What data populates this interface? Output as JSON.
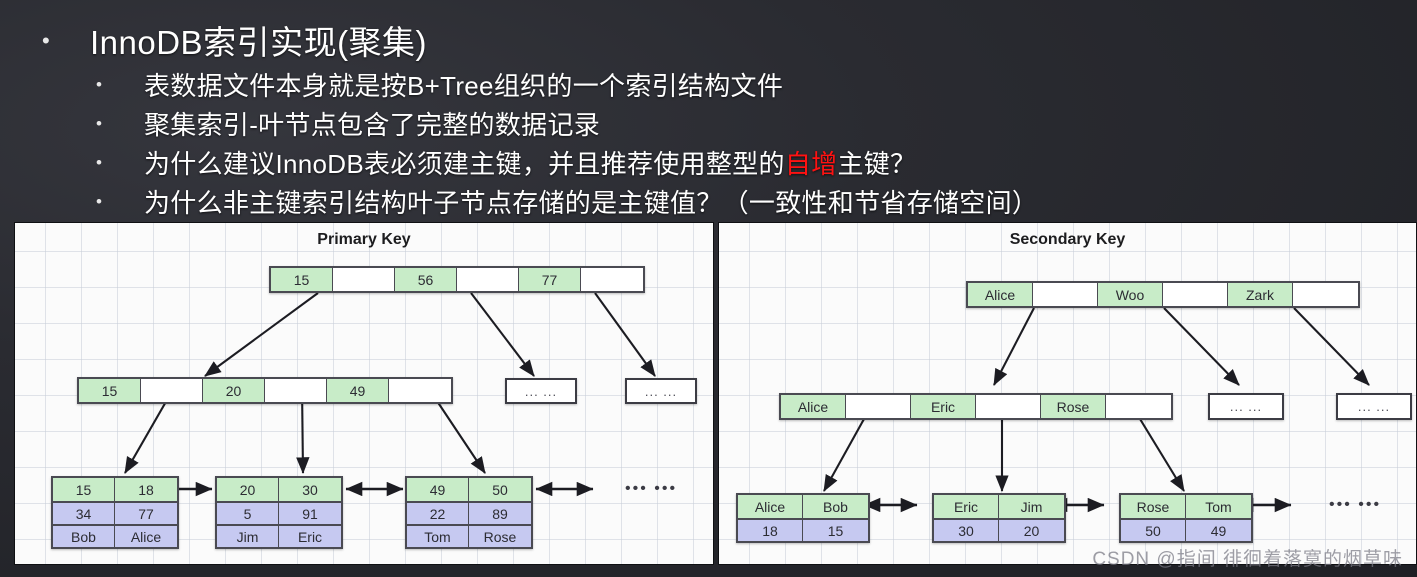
{
  "slide": {
    "bullets": [
      {
        "level": 1,
        "text": "InnoDB索引实现(聚集)"
      },
      {
        "level": 2,
        "text": "表数据文件本身就是按B+Tree组织的一个索引结构文件"
      },
      {
        "level": 2,
        "text": "聚集索引-叶节点包含了完整的数据记录"
      },
      {
        "level": 2,
        "pre": "为什么建议InnoDB表必须建主键，并且推荐使用整型的",
        "hl": "自增",
        "post": "主键？"
      },
      {
        "level": 2,
        "text": "为什么非主键索引结构叶子节点存储的是主键值？（一致性和节省存储空间）"
      }
    ]
  },
  "colors": {
    "key_green": "#c8ecc8",
    "data_purple": "#c6c9f1",
    "highlight_red": "#ff1212",
    "panel_bg": "#fbfbfb",
    "slide_bg": "#25262b"
  },
  "panels": {
    "primary": {
      "title": "Primary Key",
      "root": {
        "cells": [
          "15",
          "",
          "56",
          "",
          "77",
          ""
        ]
      },
      "internal": {
        "cells": [
          "15",
          "",
          "20",
          "",
          "49",
          ""
        ]
      },
      "internal_ellipsis": [
        "... ...",
        "... ..."
      ],
      "leaves": [
        {
          "keys": [
            "15",
            "18"
          ],
          "row2": [
            "34",
            "77"
          ],
          "row3": [
            "Bob",
            "Alice"
          ]
        },
        {
          "keys": [
            "20",
            "30"
          ],
          "row2": [
            "5",
            "91"
          ],
          "row3": [
            "Jim",
            "Eric"
          ]
        },
        {
          "keys": [
            "49",
            "50"
          ],
          "row2": [
            "22",
            "89"
          ],
          "row3": [
            "Tom",
            "Rose"
          ]
        }
      ],
      "leaf_ellipsis": "••• •••"
    },
    "secondary": {
      "title": "Secondary Key",
      "root": {
        "cells": [
          "Alice",
          "",
          "Woo",
          "",
          "Zark",
          ""
        ]
      },
      "internal": {
        "cells": [
          "Alice",
          "",
          "Eric",
          "",
          "Rose",
          ""
        ]
      },
      "internal_ellipsis": [
        "... ...",
        "... ..."
      ],
      "leaves": [
        {
          "keys": [
            "Alice",
            "Bob"
          ],
          "row2": [
            "18",
            "15"
          ]
        },
        {
          "keys": [
            "Eric",
            "Jim"
          ],
          "row2": [
            "30",
            "20"
          ]
        },
        {
          "keys": [
            "Rose",
            "Tom"
          ],
          "row2": [
            "50",
            "49"
          ]
        }
      ],
      "leaf_ellipsis": "••• •••"
    }
  },
  "watermark": "CSDN @指间  徘徊着落寞的烟草味"
}
